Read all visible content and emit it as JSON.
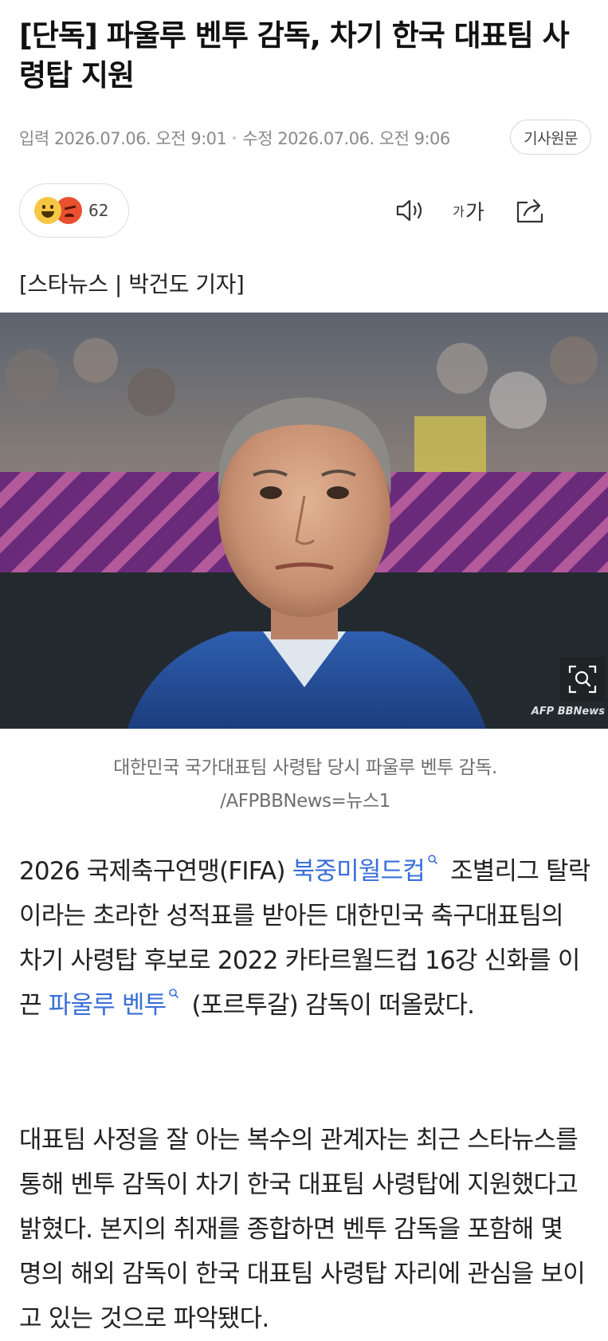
{
  "article": {
    "headline": "[단독] 파울루 벤투 감독, 차기 한국 대표팀 사령탑 지원",
    "published": "입력 2026.07.06. 오전 9:01",
    "modified": "수정 2026.07.06. 오전 9:06",
    "source_button": "기사원문",
    "byline": "[스타뉴스 | 박건도 기자]"
  },
  "toolbar": {
    "reaction_count": "62",
    "font_small": "가",
    "font_big": "가",
    "icons": [
      "happy-emoji",
      "angry-emoji",
      "audio-icon",
      "font-size-icon",
      "share-icon"
    ]
  },
  "photo": {
    "credit": "AFP BBNews",
    "caption_line1": "대한민국 국가대표팀 사령탑 당시 파울루 벤투 감독.",
    "caption_line2": "/AFPBBNews=뉴스1"
  },
  "body": {
    "p1_text1": "2026 국제축구연맹(FIFA) ",
    "p1_link1": "북중미월드컵",
    "p1_text2": " 조별리그 탈락이라는 초라한 성적표를 받아든 대한민국 축구대표팀의 차기 사령탑 후보로 2022 카타르월드컵 16강 신화를 이끈 ",
    "p1_link2": "파울루 벤투",
    "p1_text3": " (포르투갈) 감독이 떠올랐다.",
    "p2": "대표팀 사정을 잘 아는 복수의 관계자는 최근 스타뉴스를 통해 벤투 감독이 차기 한국 대표팀 사령탑에 지원했다고 밝혔다. 본지의 취재를 종합하면 벤투 감독을 포함해 몇 명의 해외 감독이 한국 대표팀 사령탑 자리에 관심을 보이고 있는 것으로 파악됐다."
  },
  "colors": {
    "link": "#3a6fd8",
    "meta": "#8a8a8a",
    "text": "#222222"
  }
}
